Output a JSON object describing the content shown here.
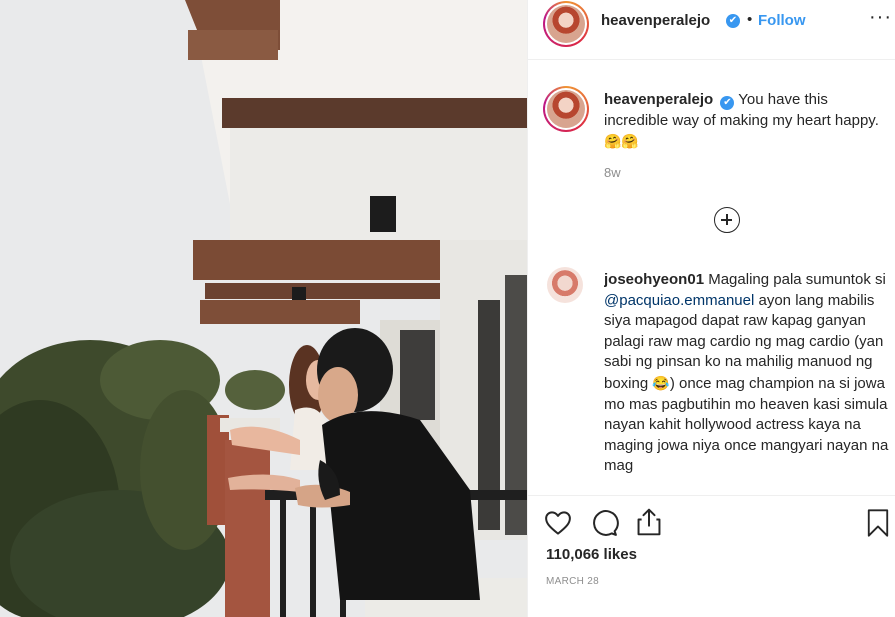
{
  "post": {
    "username": "heavenperalejo",
    "verified_mark": "✔",
    "separator": "•",
    "follow_label": "Follow",
    "more_label": "···",
    "caption": "You have this incredible way of making my heart happy.",
    "caption_emoji": "🤗🤗",
    "caption_time": "8w",
    "load_more_icon": "plus-circle-icon"
  },
  "comment": {
    "username": "joseohyeon01",
    "text_before_mention": "Magaling pala sumuntok si",
    "mention": "@pacquiao.emmanuel",
    "text_part2": "ayon lang mabilis siya mapagod dapat raw kapag ganyan palagi raw mag cardio ng mag cardio (yan sabi ng pinsan ko na mahilig manuod ng boxing",
    "emoji": "😂",
    "text_part3": ") once mag champion na si jowa mo mas pagbutihin mo heaven kasi simula nayan kahit hollywood actress kaya na maging jowa niya once mangyari nayan na mag"
  },
  "actions": {
    "icons": [
      "heart-icon",
      "comment-icon",
      "share-icon",
      "bookmark-icon"
    ],
    "likes": "110,066 likes",
    "date": "MARCH 28"
  },
  "colors": {
    "link_blue": "#3897f0",
    "mention_blue": "#003569",
    "muted_gray": "#8e8e8e",
    "text": "#262626"
  }
}
